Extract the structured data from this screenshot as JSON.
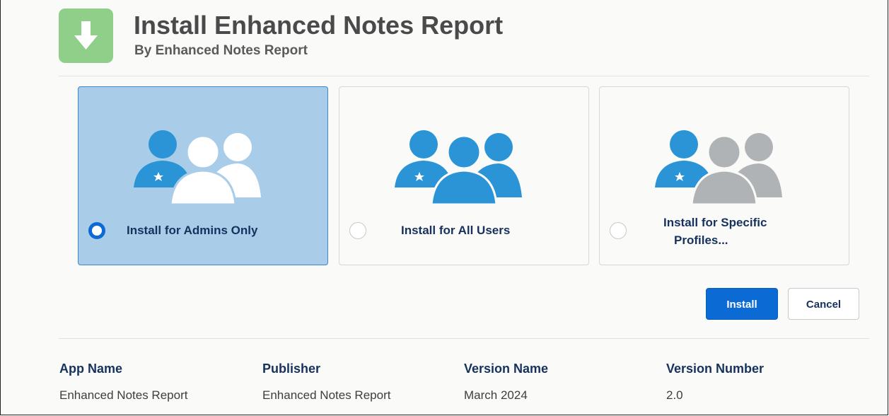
{
  "header": {
    "title": "Install Enhanced Notes Report",
    "subtitle": "By Enhanced Notes Report",
    "icon": "download-arrow-icon",
    "icon_color": "#8fcf8a"
  },
  "options": [
    {
      "label_line1": "Install for Admins Only",
      "label_line2": "",
      "selected": true,
      "icon": "users-group-icon"
    },
    {
      "label_line1": "Install for All Users",
      "label_line2": "",
      "selected": false,
      "icon": "users-group-icon"
    },
    {
      "label_line1": "Install for Specific",
      "label_line2": "Profiles...",
      "selected": false,
      "icon": "users-group-icon"
    }
  ],
  "buttons": {
    "install": "Install",
    "cancel": "Cancel"
  },
  "details": [
    {
      "heading": "App Name",
      "value": "Enhanced Notes Report"
    },
    {
      "heading": "Publisher",
      "value": "Enhanced Notes Report"
    },
    {
      "heading": "Version Name",
      "value": "March 2024"
    },
    {
      "heading": "Version Number",
      "value": "2.0"
    }
  ],
  "colors": {
    "accent_blue": "#0b6ad3",
    "selected_bg": "#a9cde8",
    "user_blue": "#2a94d6",
    "user_gray": "#b0b3b6",
    "user_white": "#ffffff"
  }
}
